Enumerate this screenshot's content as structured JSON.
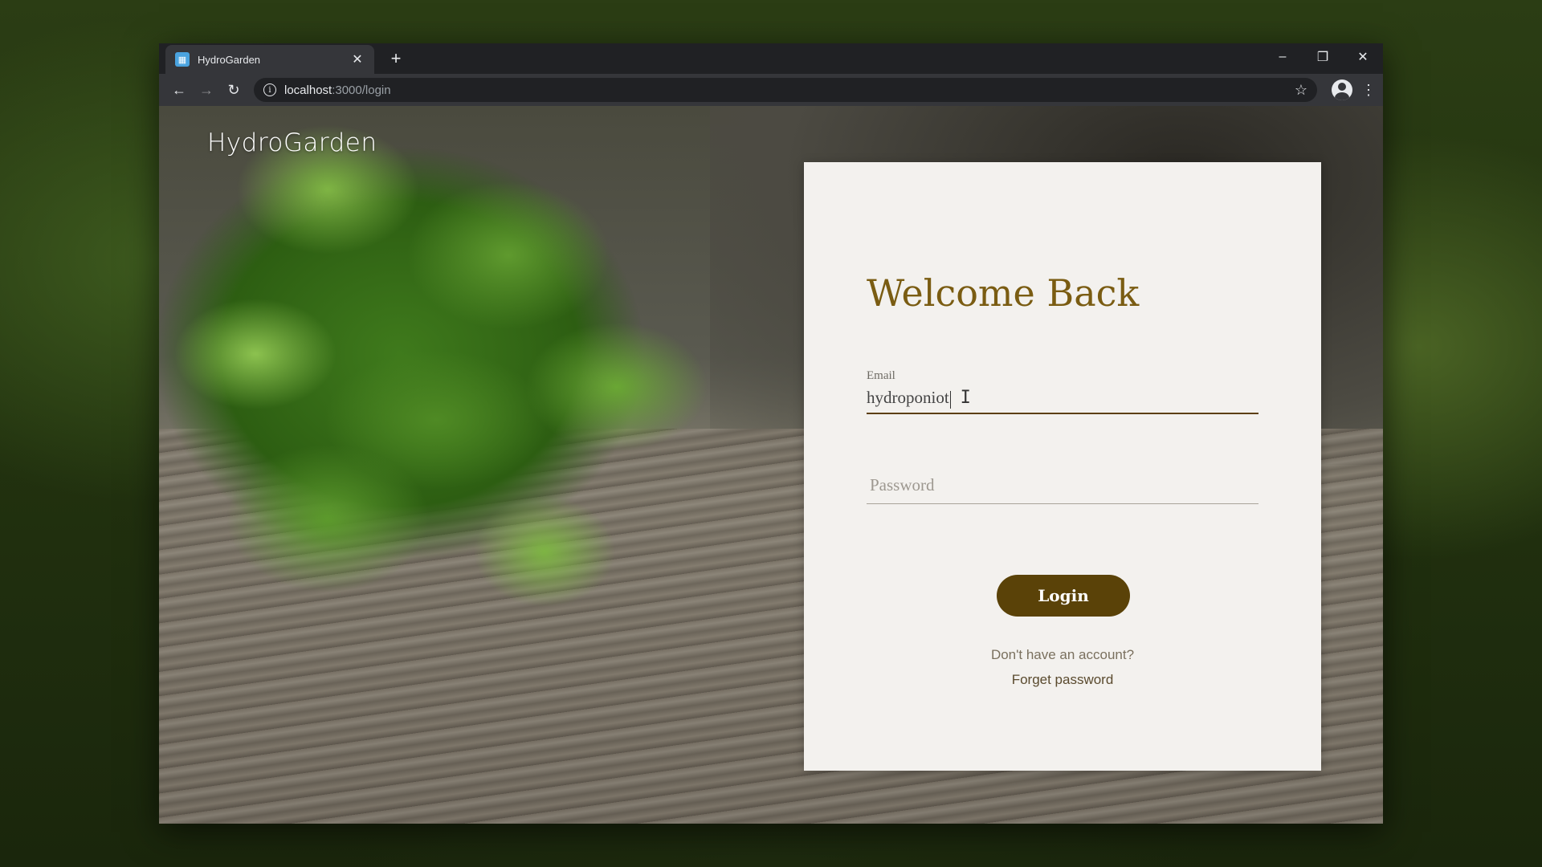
{
  "browser": {
    "tab_title": "HydroGarden",
    "tab_close": "✕",
    "new_tab": "+",
    "url_host": "localhost",
    "url_path": ":3000/login",
    "window_controls": {
      "minimize": "–",
      "restore": "❐",
      "close": "✕"
    },
    "nav": {
      "back": "←",
      "forward": "→",
      "reload": "↻"
    }
  },
  "page": {
    "brand": "HydroGarden",
    "heading": "Welcome Back",
    "email_label": "Email",
    "email_value": "hydroponiot",
    "password_placeholder": "Password",
    "login_label": "Login",
    "signup_link": "Don't have an account?",
    "forgot_link": "Forget password"
  },
  "colors": {
    "accent": "#7a5c12",
    "button": "#5a4208",
    "card": "#f3f1ee"
  }
}
